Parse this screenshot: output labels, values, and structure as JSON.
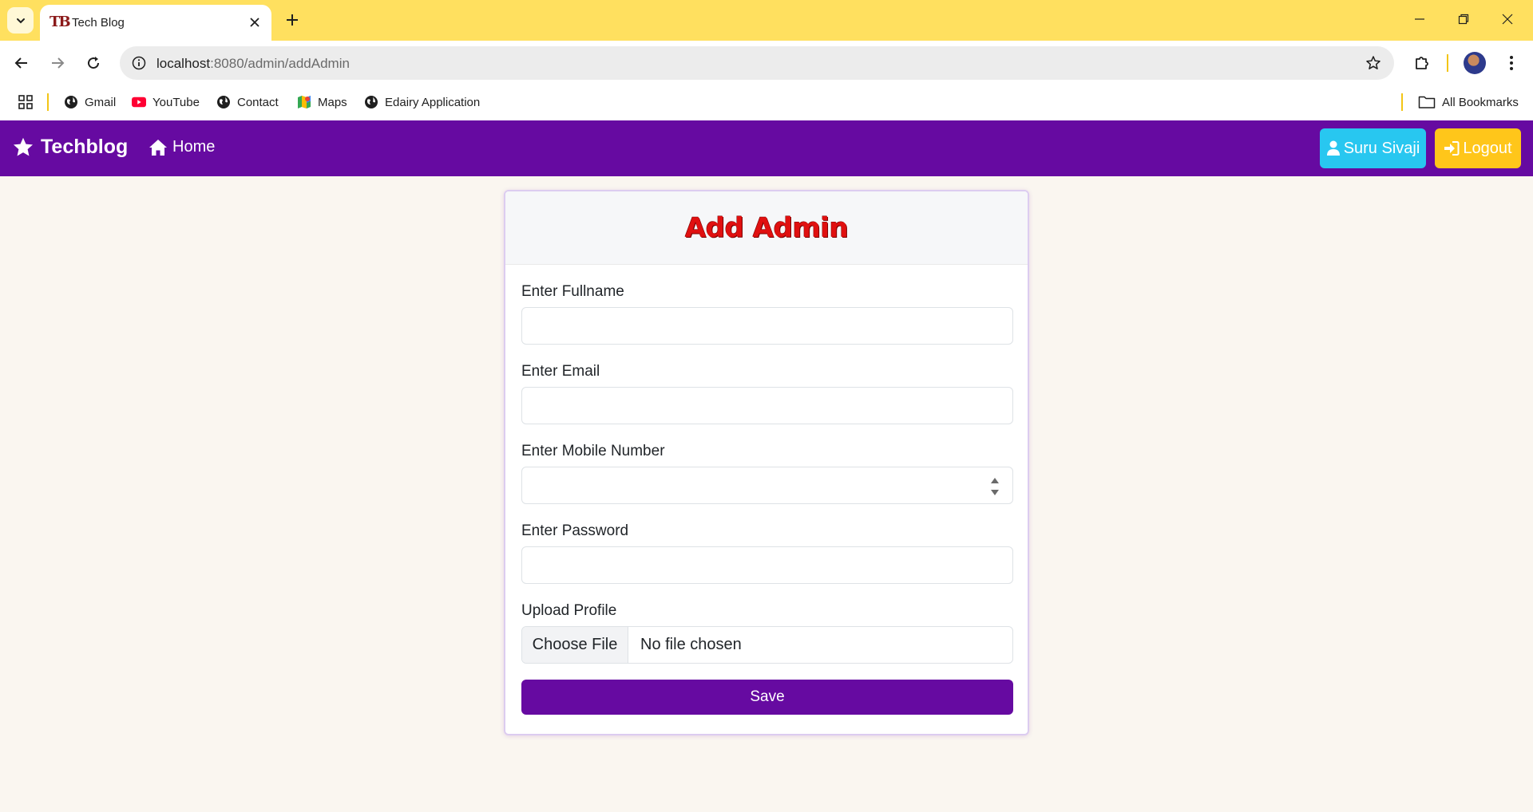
{
  "browser": {
    "tab_title": "Tech Blog",
    "favicon_text": "TB",
    "url_host": "localhost",
    "url_rest": ":8080/admin/addAdmin",
    "bookmarks": [
      {
        "label": "Gmail",
        "icon": "globe-icon"
      },
      {
        "label": "YouTube",
        "icon": "youtube-icon"
      },
      {
        "label": "Contact",
        "icon": "globe-icon"
      },
      {
        "label": "Maps",
        "icon": "maps-icon"
      },
      {
        "label": "Edairy Application",
        "icon": "globe-icon"
      }
    ],
    "all_bookmarks": "All Bookmarks",
    "accent": "#ffe05f"
  },
  "navbar": {
    "brand": "Techblog",
    "home": "Home",
    "user_button": "Suru Sivaji",
    "logout_button": "Logout",
    "bg": "#660aa1"
  },
  "form": {
    "title": "Add Admin",
    "fields": {
      "fullname_label": "Enter Fullname",
      "email_label": "Enter Email",
      "mobile_label": "Enter Mobile Number",
      "password_label": "Enter Password",
      "upload_label": "Upload Profile"
    },
    "file_button": "Choose File",
    "file_status": "No file chosen",
    "save_button": "Save"
  }
}
